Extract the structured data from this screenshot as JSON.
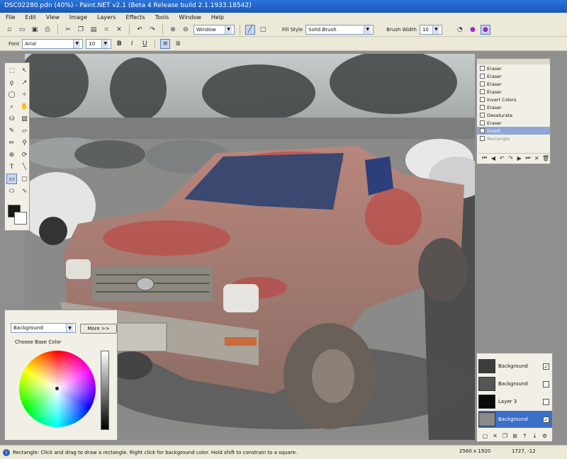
{
  "window": {
    "title": "DSC02280.pdn (40%) - Paint.NET v2.1 (Beta 4 Release build 2.1.1933.18542)"
  },
  "menu": [
    "File",
    "Edit",
    "View",
    "Image",
    "Layers",
    "Effects",
    "Tools",
    "Window",
    "Help"
  ],
  "toolbar": {
    "zoom_value": "Window",
    "fill_style_label": "Fill Style",
    "fill_style_value": "Solid Brush",
    "brush_width_label": "Brush Width",
    "brush_width_value": "10",
    "font_label": "Font",
    "font_value": "Arial",
    "font_size_value": "10",
    "bold": "B",
    "italic": "I",
    "underline": "U"
  },
  "history": {
    "items": [
      {
        "label": "Eraser",
        "state": "normal"
      },
      {
        "label": "Eraser",
        "state": "normal"
      },
      {
        "label": "Eraser",
        "state": "normal"
      },
      {
        "label": "Eraser",
        "state": "normal"
      },
      {
        "label": "Invert Colors",
        "state": "normal"
      },
      {
        "label": "Eraser",
        "state": "normal"
      },
      {
        "label": "Desaturate",
        "state": "normal"
      },
      {
        "label": "Eraser",
        "state": "normal"
      },
      {
        "label": "Invert",
        "state": "selected"
      },
      {
        "label": "Rectangle",
        "state": "dim"
      }
    ]
  },
  "colors": {
    "primary_select": "Background",
    "more_button": "More >>",
    "subtitle": "Choose Base Color",
    "accent_primary": "#1a1a1a",
    "accent_secondary": "#ffffff"
  },
  "layers": {
    "items": [
      {
        "label": "Background",
        "checked": true,
        "selected": false
      },
      {
        "label": "Background",
        "checked": false,
        "selected": false
      },
      {
        "label": "Layer 3",
        "checked": false,
        "selected": false
      },
      {
        "label": "Background",
        "checked": true,
        "selected": true
      }
    ]
  },
  "status": {
    "message": "Rectangle: Click and drag to draw a rectangle. Right click for background color. Hold shift to constrain to a square.",
    "image_size": "2560 x 1920",
    "cursor_pos": "1727, -12"
  }
}
